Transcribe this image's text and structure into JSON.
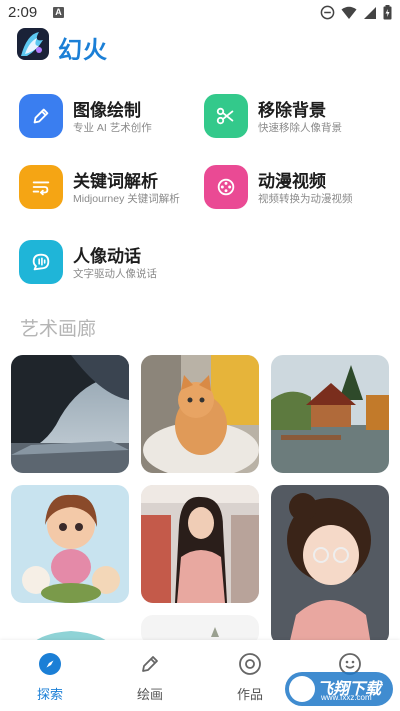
{
  "status_bar": {
    "time": "2:09",
    "notif_badge": "A"
  },
  "header": {
    "app_name": "幻火"
  },
  "features": [
    {
      "title": "图像绘制",
      "subtitle": "专业 AI 艺术创作",
      "icon": "pencil-icon",
      "color": "#3a7ef0"
    },
    {
      "title": "移除背景",
      "subtitle": "快速移除人像背景",
      "icon": "scissors-icon",
      "color": "#33c98b"
    },
    {
      "title": "关键词解析",
      "subtitle": "Midjourney 关键词解析",
      "icon": "keyword-icon",
      "color": "#f5a514"
    },
    {
      "title": "动漫视频",
      "subtitle": "视频转换为动漫视频",
      "icon": "film-icon",
      "color": "#ea4a94"
    },
    {
      "title": "人像动话",
      "subtitle": "文字驱动人像说话",
      "icon": "speech-icon",
      "color": "#1fb5d8"
    }
  ],
  "gallery": {
    "title": "艺术画廊"
  },
  "nav": [
    {
      "label": "探索",
      "icon": "compass-icon"
    },
    {
      "label": "绘画",
      "icon": "brush-icon"
    },
    {
      "label": "作品",
      "icon": "target-icon"
    },
    {
      "label": "",
      "icon": "smile-icon"
    }
  ],
  "watermark": {
    "text": "飞翔下载",
    "sub": "www.fxxz.com"
  },
  "colors": {
    "accent": "#1b7fd6"
  }
}
